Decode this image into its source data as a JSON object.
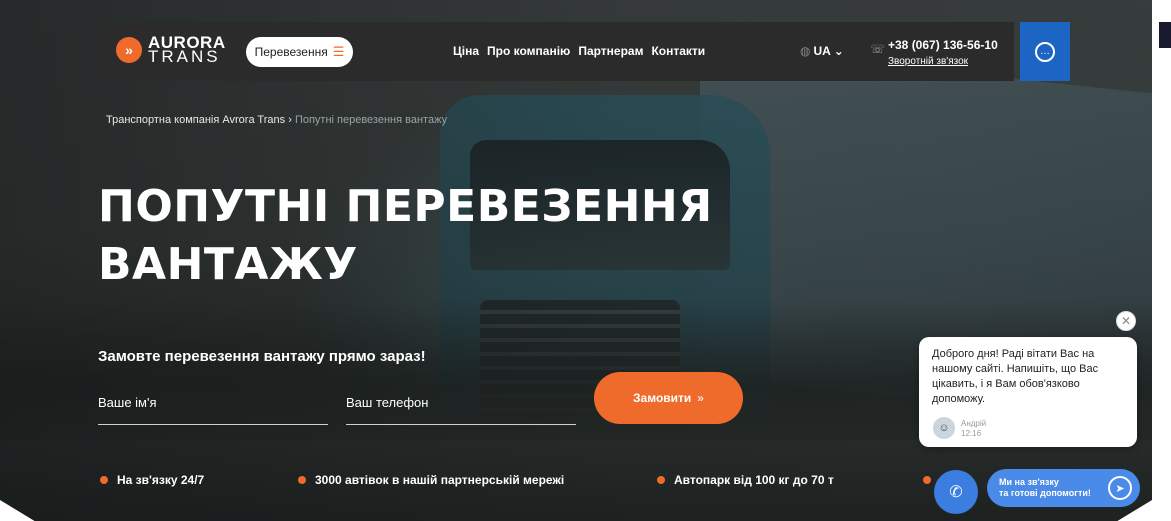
{
  "header": {
    "logo_line1": "AURORA",
    "logo_line2": "TRANS",
    "logo_mark": "»",
    "services_label": "Перевезення",
    "nav": [
      "Ціна",
      "Про компанію",
      "Партнерам",
      "Контакти"
    ],
    "lang": "UA",
    "phone": "+38 (067) 136-56-10",
    "callback": "Зворотній зв'язок"
  },
  "breadcrumb": {
    "home": "Транспортна компанія Avrora Trans",
    "separator": "›",
    "current": "Попутні перевезення вантажу"
  },
  "hero": {
    "title_line1": "ПОПУТНІ ПЕРЕВЕЗЕННЯ",
    "title_line2": "ВАНТАЖУ"
  },
  "order_form": {
    "heading": "Замовте перевезення вантажу прямо зараз!",
    "name_placeholder": "Ваше ім'я",
    "phone_placeholder": "Ваш телефон",
    "submit_label": "Замовити",
    "submit_arrow": "»"
  },
  "features": [
    "На зв'язку 24/7",
    "3000 автівок в нашій партнерській мережі",
    "Автопарк від 100 кг до 70 т",
    "…"
  ],
  "chat": {
    "message": "Доброго дня! Раді вітати Вас на нашому сайті. Напишіть, що Вас цікавить, і я Вам обов'язково допоможу.",
    "agent_name": "Андрій",
    "agent_time": "12:16",
    "telegram_line1": "Ми на зв'язку",
    "telegram_line2": "та готові допомогти!"
  },
  "colors": {
    "accent": "#ef6b2c",
    "header_bg": "#2b2b2b",
    "chat_blue": "#1d65c4"
  }
}
